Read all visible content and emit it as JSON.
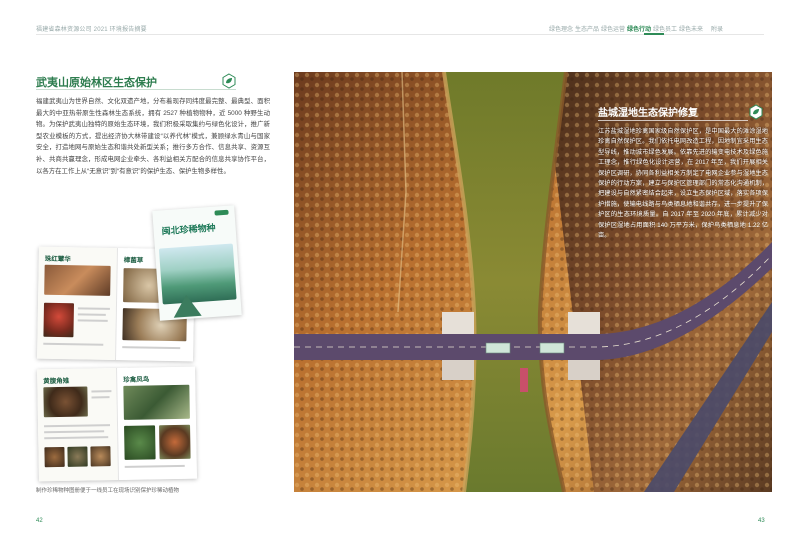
{
  "header": {
    "doc_title": "福建省森林资源公司 2021 环境报告摘要",
    "nav": [
      {
        "label": "绿色理念",
        "active": false
      },
      {
        "label": "生态产品",
        "active": false
      },
      {
        "label": "绿色运营",
        "active": false
      },
      {
        "label": "绿色行动",
        "active": true
      },
      {
        "label": "绿色员工",
        "active": false
      },
      {
        "label": "绿色未来",
        "active": false
      },
      {
        "label": "附录",
        "active": false
      }
    ]
  },
  "left": {
    "section_title": "武夷山原始林区生态保护",
    "body": "福建武夷山为世界自然、文化双遗产地，分布着现存同纬度最完整、最典型、面积最大的中亚热带原生性森林生态系统，拥有 2527 种植物物种，近 5000 种野生动物。为保护武夷山独特的原始生态环境，我们积极采取集约与绿色化设计，推广新型农业模板的方式，提出经济协大林带建设“以养代林”模式，兼顾绿水青山与国家安全，打造地网与原始生态和谐共处新型关系；推行多方合作、信息共享、资源互补、共商共赢理念，形成电网企业牵头、各利益相关方配合的信息共享协作平台，以各方在工作上从“无意识”到“有意识”的保护生态、保护生物多样性。",
    "brochure": {
      "cover_title": "闽北珍稀物种",
      "spread1_left_title": "珠红蕈华",
      "spread1_right_title": "樟菌草",
      "spread2_left_title": "黄腹角雉",
      "spread2_right_title": "珍禽凤鸟"
    },
    "caption": "制作珍稀物种图册便于一线员工在现场识别保护珍稀动植物",
    "page_number": "42"
  },
  "right": {
    "overlay_title": "盐城湿地生态保护修复",
    "overlay_body": "江苏盐城湿地珍禽国家级自然保护区，是中国最大的滩涂湿地珍禽自然保护区。我们依托电网改造工程，因地制宜采用生态型导线，推动城市绿色发展。依靠先进的输变电技术及绿色施工理念，推行绿色化设计运营，在 2017 年至，我们开展相关保护区调研，协同各利益相关方制定了电网企业参与湿地生态保护的行动方案，建立与保护区管理部门的常态化沟通机制，把建设与自然紧密结合起来，设立生态保护区域，落实各项保护措施，使输电线路与鸟类栖息地和谐共存，进一步提升了保护区的生态环境质量。自 2017 年至 2020 年底，累计减少对保护区湿地占用面积 140 万平方米，保护鸟类栖息地 1.22 亿亩。",
    "page_number": "43"
  },
  "colors": {
    "accent_green": "#2e8b57",
    "title_green": "#2e7d4f"
  }
}
